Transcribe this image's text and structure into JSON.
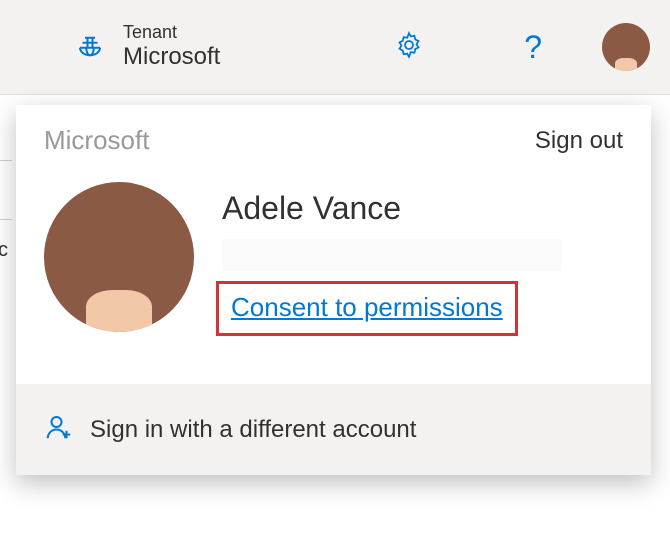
{
  "header": {
    "tenant_label": "Tenant",
    "tenant_name": "Microsoft"
  },
  "panel": {
    "org": "Microsoft",
    "signout": "Sign out",
    "user_name": "Adele Vance",
    "consent_label": "Consent to permissions",
    "switch_account_label": "Sign in with a different account"
  }
}
